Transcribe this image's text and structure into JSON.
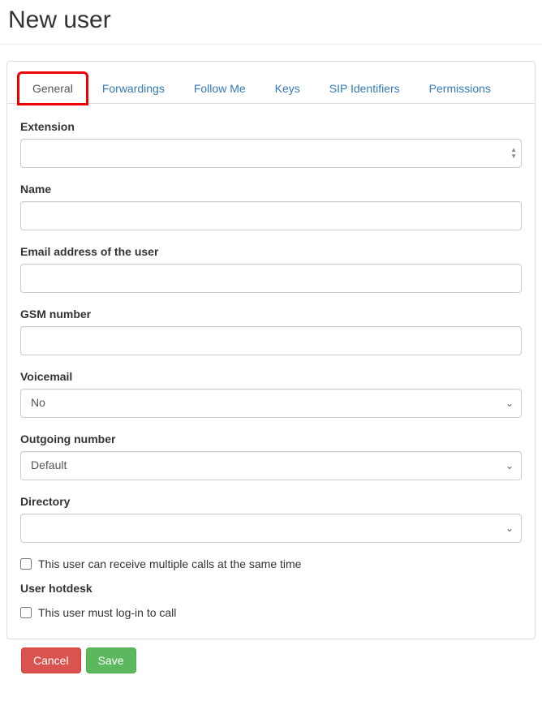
{
  "page": {
    "title": "New user"
  },
  "tabs": [
    {
      "label": "General",
      "active": true,
      "highlighted": true
    },
    {
      "label": "Forwardings",
      "active": false
    },
    {
      "label": "Follow Me",
      "active": false
    },
    {
      "label": "Keys",
      "active": false
    },
    {
      "label": "SIP Identifiers",
      "active": false
    },
    {
      "label": "Permissions",
      "active": false
    }
  ],
  "form": {
    "extension_label": "Extension",
    "extension_value": "",
    "name_label": "Name",
    "name_value": "",
    "email_label": "Email address of the user",
    "email_value": "",
    "gsm_label": "GSM number",
    "gsm_value": "",
    "voicemail_label": "Voicemail",
    "voicemail_value": "No",
    "outgoing_label": "Outgoing number",
    "outgoing_value": "Default",
    "directory_label": "Directory",
    "directory_value": "",
    "multicalls_label": "This user can receive multiple calls at the same time",
    "multicalls_checked": false,
    "hotdesk_heading": "User hotdesk",
    "hotdesk_login_label": "This user must log-in to call",
    "hotdesk_login_checked": false
  },
  "buttons": {
    "cancel": "Cancel",
    "save": "Save"
  }
}
